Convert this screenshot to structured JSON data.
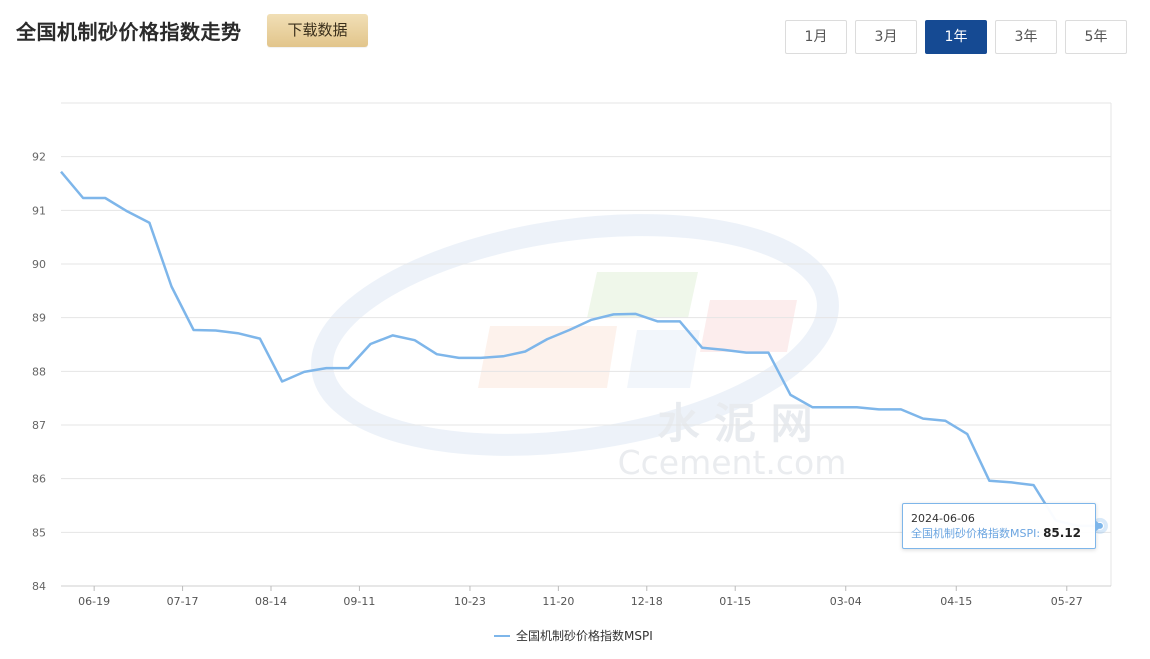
{
  "page": {
    "title": "全国机制砂价格指数走势",
    "download_label": "下载数据"
  },
  "range_tabs": [
    {
      "label": "1月",
      "active": false
    },
    {
      "label": "3月",
      "active": false
    },
    {
      "label": "1年",
      "active": true
    },
    {
      "label": "3年",
      "active": false
    },
    {
      "label": "5年",
      "active": false
    }
  ],
  "watermark": {
    "text_cn": "水 泥 网",
    "text_en": "Ccement.com"
  },
  "tooltip": {
    "date": "2024-06-06",
    "series_label": "全国机制砂价格指数MSPI:",
    "value": "85.12"
  },
  "colors": {
    "line": "#7eb6ea",
    "accent": "#154a93",
    "grid": "#e5e5e5"
  },
  "chart_data": {
    "type": "line",
    "title": "全国机制砂价格指数走势",
    "xlabel": "",
    "ylabel": "",
    "ylim": [
      84,
      93
    ],
    "yticks": [
      84,
      85,
      86,
      87,
      88,
      89,
      90,
      91,
      92
    ],
    "grid": true,
    "legend_position": "bottom-center",
    "x_tick_labels": [
      "06-19",
      "07-17",
      "08-14",
      "09-11",
      "10-23",
      "11-20",
      "12-18",
      "01-15",
      "03-04",
      "04-15",
      "05-27"
    ],
    "x_tick_index": [
      1.5,
      5.5,
      9.5,
      13.5,
      18.5,
      22.5,
      26.5,
      30.5,
      35.5,
      40.5,
      45.5
    ],
    "series": [
      {
        "name": "全国机制砂价格指数MSPI",
        "values": [
          91.72,
          91.23,
          91.23,
          90.98,
          90.77,
          89.58,
          88.77,
          88.76,
          88.71,
          88.61,
          87.81,
          87.99,
          88.06,
          88.06,
          88.51,
          88.67,
          88.58,
          88.32,
          88.25,
          88.25,
          88.28,
          88.37,
          88.6,
          88.77,
          88.96,
          89.06,
          89.07,
          88.93,
          88.93,
          88.44,
          88.4,
          88.35,
          88.35,
          87.56,
          87.33,
          87.33,
          87.33,
          87.29,
          87.29,
          87.12,
          87.08,
          86.83,
          85.96,
          85.93,
          85.88,
          85.22,
          85.12,
          85.12
        ]
      }
    ]
  }
}
